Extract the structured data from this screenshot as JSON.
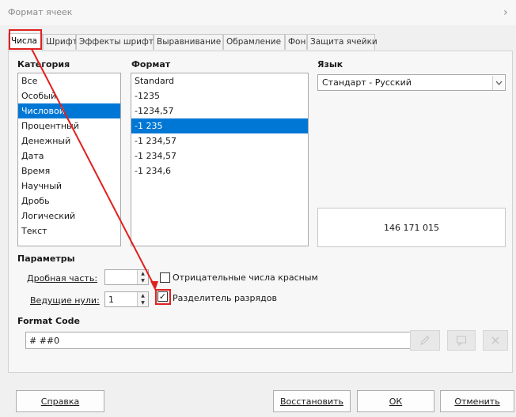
{
  "window": {
    "title": "Формат ячеек",
    "close_glyph": "›"
  },
  "tabs": [
    {
      "label": "Числа",
      "active": true
    },
    {
      "label": "Шрифт"
    },
    {
      "label": "Эффекты шрифта"
    },
    {
      "label": "Выравнивание"
    },
    {
      "label": "Обрамление"
    },
    {
      "label": "Фон"
    },
    {
      "label": "Защита ячейки"
    }
  ],
  "category": {
    "label": "Категория",
    "items": [
      "Все",
      "Особый",
      "Числовой",
      "Процентный",
      "Денежный",
      "Дата",
      "Время",
      "Научный",
      "Дробь",
      "Логический",
      "Текст"
    ],
    "selected": "Числовой"
  },
  "format": {
    "label": "Формат",
    "items": [
      "Standard",
      "-1235",
      "-1234,57",
      "-1 235",
      "-1 234,57",
      "-1 234,57",
      "-1 234,6"
    ],
    "selected": "-1 235"
  },
  "language": {
    "label": "Язык",
    "value": "Стандарт - Русский"
  },
  "preview": {
    "value": "146 171 015"
  },
  "options": {
    "label": "Параметры",
    "decimal_label": "Дробная часть:",
    "decimal_value": "",
    "leading_label": "Ведущие нули:",
    "leading_value": "1",
    "negative_red_label": "Отрицательные числа красным",
    "negative_red_checked": false,
    "thousands_sep_label": "Разделитель разрядов",
    "thousands_sep_checked": true
  },
  "format_code": {
    "label": "Format Code",
    "value": "# ##0"
  },
  "buttons": {
    "help": "Справка",
    "reset": "Восстановить",
    "ok": "ОК",
    "cancel": "Отменить"
  },
  "colors": {
    "accent": "#0077d4",
    "highlight": "#e02020"
  },
  "icons": {
    "spin_up": "▲",
    "spin_down": "▼",
    "check": "✓",
    "edit": "pencil-icon",
    "comment": "comment-icon",
    "delete": "delete-icon"
  }
}
